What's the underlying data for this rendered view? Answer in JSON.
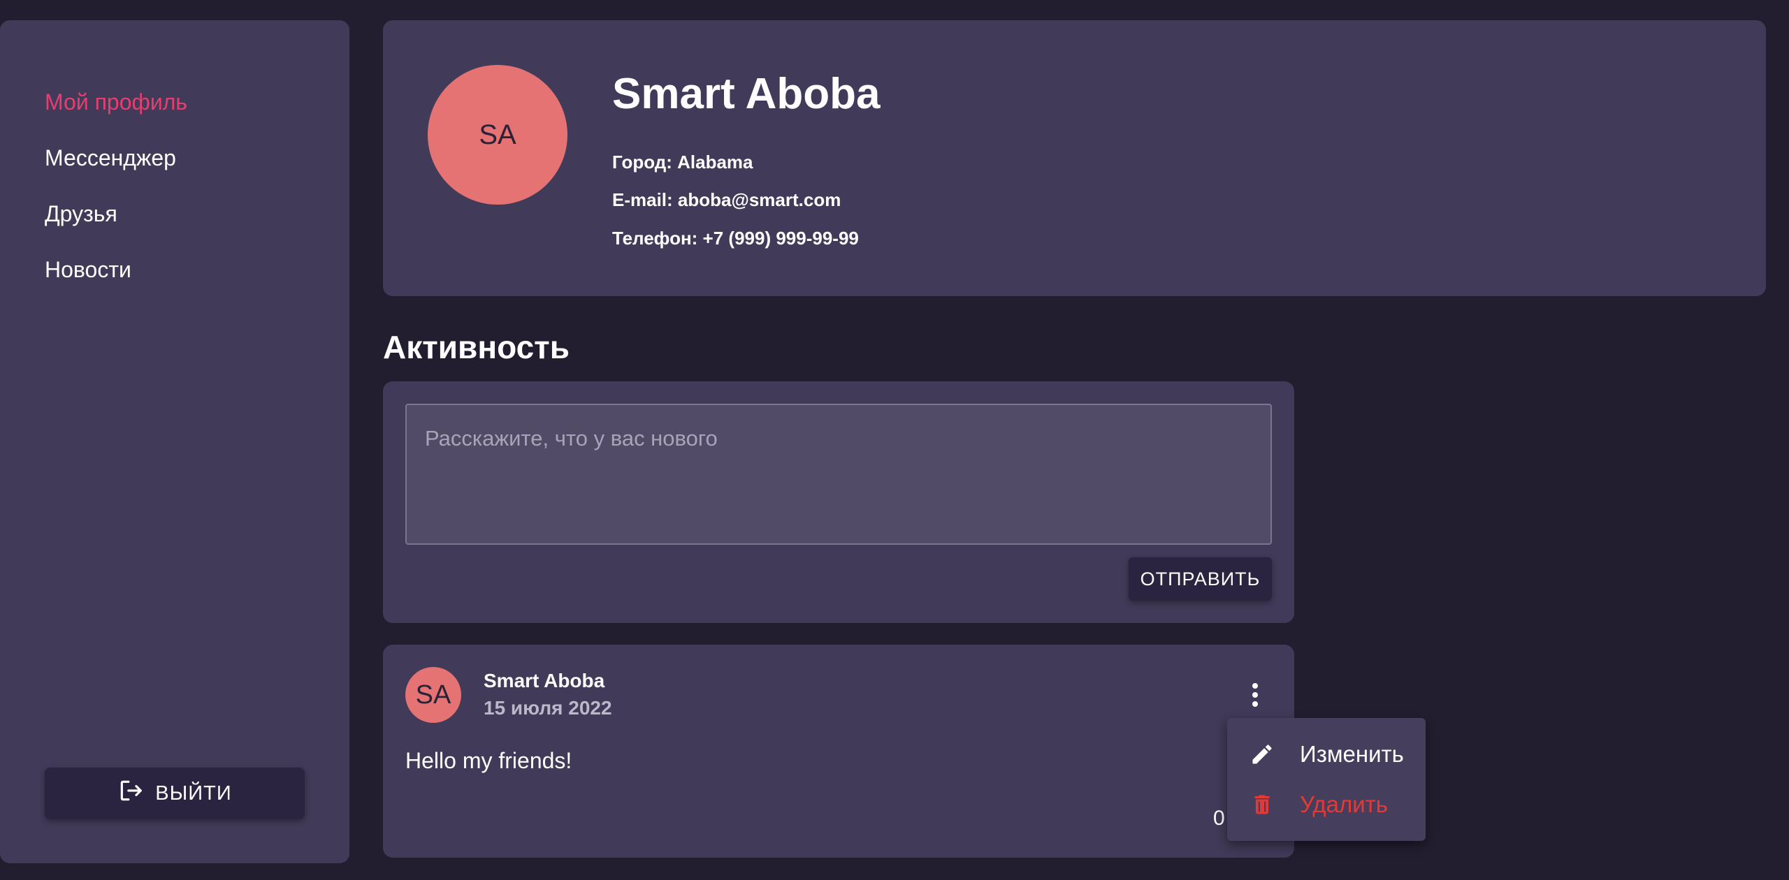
{
  "sidebar": {
    "items": [
      {
        "label": "Мой профиль",
        "active": true
      },
      {
        "label": "Мессенджер",
        "active": false
      },
      {
        "label": "Друзья",
        "active": false
      },
      {
        "label": "Новости",
        "active": false
      }
    ],
    "logout_label": "ВЫЙТИ",
    "logout_icon": "logout-icon"
  },
  "profile": {
    "initials": "SA",
    "name": "Smart Aboba",
    "city": "Город: Alabama",
    "email": "E-mail: aboba@smart.com",
    "phone": "Телефон: +7 (999) 999-99-99"
  },
  "activity": {
    "title": "Активность",
    "composer": {
      "placeholder": "Расскажите, что у вас нового",
      "value": "",
      "send_label": "ОТПРАВИТЬ"
    }
  },
  "post": {
    "initials": "SA",
    "author": "Smart Aboba",
    "date": "15 июля 2022",
    "text": "Hello my friends!",
    "count": "0",
    "menu_icon": "more-vert-icon"
  },
  "post_menu": {
    "edit_label": "Изменить",
    "delete_label": "Удалить",
    "edit_icon": "pencil-icon",
    "delete_icon": "trash-icon"
  },
  "colors": {
    "background": "#221e30",
    "card": "#413a58",
    "accent": "#e53f72",
    "avatar": "#e57373",
    "danger": "#e53935"
  }
}
